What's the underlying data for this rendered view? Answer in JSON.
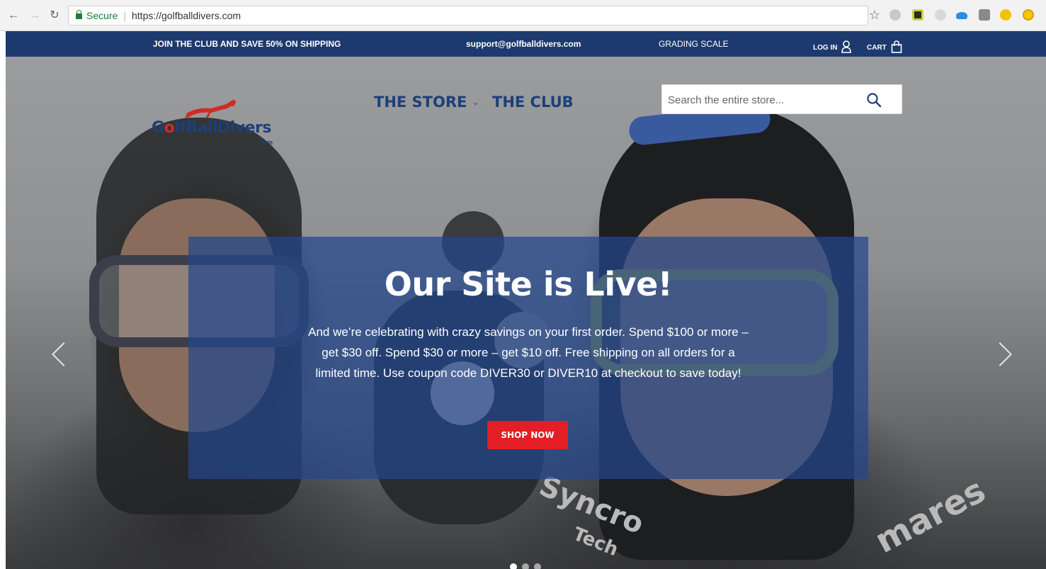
{
  "browser": {
    "secure_label": "Secure",
    "url": "https://golfballdivers.com"
  },
  "topbar": {
    "promo": "JOIN THE CLUB AND SAVE 50% ON SHIPPING",
    "email": "support@golfballdivers.com",
    "grading": "GRADING SCALE",
    "login": "LOG IN",
    "cart": "CART"
  },
  "header": {
    "logo_text_1": "G",
    "logo_text_o": "o",
    "logo_text_2": "lfBallDivers",
    "logo_com": ".com",
    "nav": [
      {
        "label": "THE STORE"
      },
      {
        "label": "THE CLUB"
      }
    ],
    "search_placeholder": "Search the entire store..."
  },
  "hero": {
    "title": "Our Site is Live!",
    "body": "And we’re celebrating with crazy savings on your first order. Spend $100 or more – get $30 off. Spend $30 or more – get $10 off. Free shipping on all orders for a limited time. Use coupon code DIVER30 or DIVER10 at checkout to save today!",
    "cta": "SHOP NOW",
    "photo_text_1": "Syncro",
    "photo_text_2": "Tech",
    "photo_text_3": "mares",
    "slides": 3,
    "active_slide": 1
  },
  "colors": {
    "brand_navy": "#1d3a6e",
    "cta_red": "#e31e24"
  }
}
